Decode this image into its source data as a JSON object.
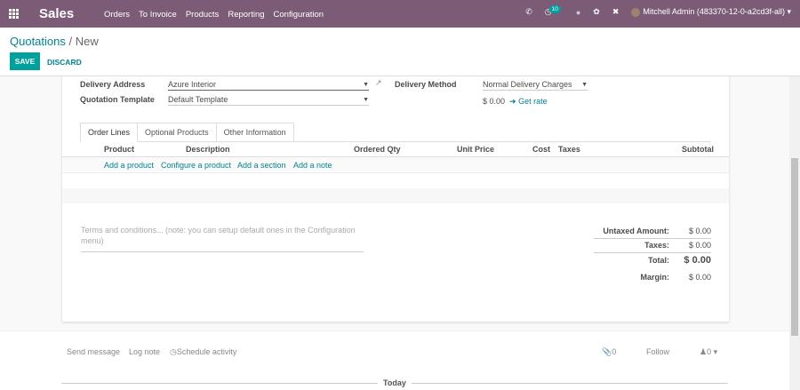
{
  "nav": {
    "app": "Sales",
    "menu": [
      "Orders",
      "To Invoice",
      "Products",
      "Reporting",
      "Configuration"
    ],
    "activity_count": "10",
    "user": "Mitchell Admin (483370-12-0-a2cd3f-all)"
  },
  "breadcrumb": {
    "parent": "Quotations",
    "current": "New"
  },
  "buttons": {
    "save": "SAVE",
    "discard": "DISCARD"
  },
  "form": {
    "delivery_address_label": "Delivery Address",
    "delivery_address": "Azure Interior",
    "template_label": "Quotation Template",
    "template": "Default Template",
    "delivery_method_label": "Delivery Method",
    "delivery_method": "Normal Delivery Charges",
    "delivery_price": "$ 0.00",
    "get_rate": "Get rate"
  },
  "tabs": [
    "Order Lines",
    "Optional Products",
    "Other Information"
  ],
  "columns": [
    "Product",
    "Description",
    "Ordered Qty",
    "Unit Price",
    "Cost",
    "Taxes",
    "Subtotal"
  ],
  "add_links": [
    "Add a product",
    "Configure a product",
    "Add a section",
    "Add a note"
  ],
  "terms_placeholder": "Terms and conditions... (note: you can setup default ones in the Configuration menu)",
  "totals": {
    "untaxed_label": "Untaxed Amount:",
    "untaxed": "$ 0.00",
    "taxes_label": "Taxes:",
    "taxes": "$ 0.00",
    "total_label": "Total:",
    "total": "$ 0.00",
    "margin_label": "Margin:",
    "margin": "$ 0.00"
  },
  "chatter": {
    "send": "Send message",
    "log": "Log note",
    "schedule": "Schedule activity",
    "attachments": "0",
    "follow": "Follow",
    "followers": "0",
    "today": "Today"
  }
}
